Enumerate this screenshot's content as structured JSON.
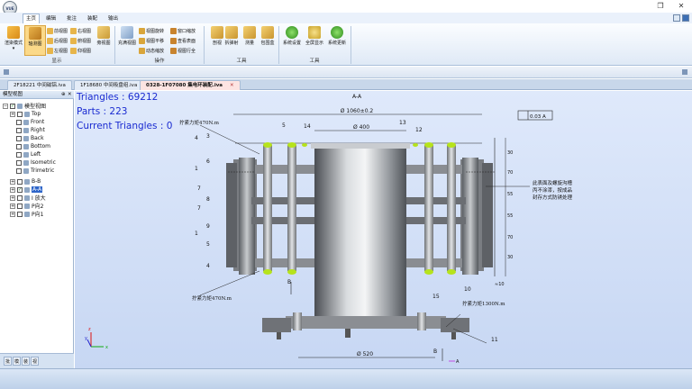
{
  "app": {
    "logo_text": "VUE",
    "restore_icon": "restore-icon",
    "close_icon": "close-icon"
  },
  "menu_tabs": [
    {
      "label": "主页",
      "active": true
    },
    {
      "label": "编辑",
      "active": false
    },
    {
      "label": "批注",
      "active": false
    },
    {
      "label": "装配",
      "active": false
    },
    {
      "label": "输出",
      "active": false
    }
  ],
  "ribbon": {
    "groups": {
      "display": "显示",
      "operate": "操作",
      "tools1": "工具",
      "tools2": "工具"
    },
    "display": {
      "render_mode": "渲染模式",
      "axis_view": "轴测图",
      "small": [
        "前视图",
        "后视图",
        "左视图",
        "右视图",
        "俯视图",
        "仰视图"
      ],
      "bounding": "旁视图"
    },
    "operate": {
      "fullscreen_view": "充满视图",
      "small": [
        "视图旋转",
        "视图平移",
        "动态缩放",
        "窗口缩放",
        "查看表面",
        "视图行全"
      ]
    },
    "tools": [
      "剖视",
      "拆弹射",
      "测量",
      "包围盒"
    ],
    "system": [
      "系统设置",
      "全屏显示",
      "系统更新"
    ]
  },
  "doc_tabs": [
    {
      "label": "2F18221 中间磁铝.iva",
      "active": false
    },
    {
      "label": "1F18680 中间吸盘组.iva",
      "active": false
    },
    {
      "label": "0328-1F07080 集电环装配.iva",
      "active": true
    }
  ],
  "side_panel": {
    "title": "模型视图",
    "root": "模型视图",
    "views": [
      {
        "label": "Top",
        "checked": false
      },
      {
        "label": "Front",
        "checked": false
      },
      {
        "label": "Right",
        "checked": false
      },
      {
        "label": "Back",
        "checked": false
      },
      {
        "label": "Bottom",
        "checked": false
      },
      {
        "label": "Left",
        "checked": false
      },
      {
        "label": "Isometric",
        "checked": false
      },
      {
        "label": "Trimetric",
        "checked": false
      },
      {
        "label": "B-B",
        "checked": false
      },
      {
        "label": "A-A",
        "checked": true
      },
      {
        "label": "I 放大",
        "checked": false
      },
      {
        "label": "P向2",
        "checked": false
      },
      {
        "label": "P向1",
        "checked": false
      }
    ],
    "bottom_tabs": [
      "批",
      "模",
      "装",
      "视"
    ]
  },
  "viewport": {
    "triangles_label": "Triangles : 69212",
    "parts_label": "Parts : 223",
    "current_triangles_label": "Current Triangles : 0",
    "drawing": {
      "section_title": "A-A",
      "dim_top": "Ø 1060±0.2",
      "dim_400": "Ø 400",
      "dim_520": "Ø 520",
      "tolerance_box": "0.03 A",
      "torque_top": "拧紧力矩470N.m",
      "torque_bottom": "拧紧力矩470N.m",
      "torque_right": "拧紧力矩1300N.m",
      "note_lines": [
        "此表面及螺旋沟槽",
        "丙不涂漆，按成品",
        "封存方式防锈处理"
      ],
      "balloons": [
        "5",
        "4",
        "3",
        "6",
        "1",
        "7",
        "8",
        "7",
        "9",
        "1",
        "5",
        "4",
        "14",
        "13",
        "12",
        "15",
        "10",
        "11",
        "B",
        "B"
      ],
      "dims_right": [
        "30",
        "70",
        "55",
        "55",
        "70",
        "30",
        "≈10"
      ],
      "datum": "A"
    },
    "axes": {
      "z": "z",
      "y": "y",
      "x": "x"
    }
  }
}
